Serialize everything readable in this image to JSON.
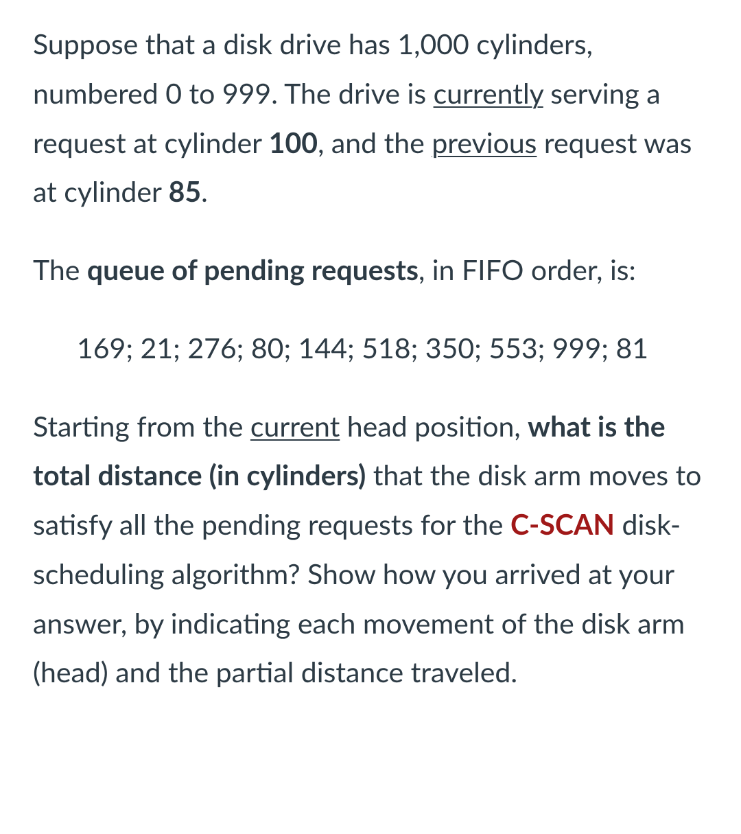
{
  "para1": {
    "seg1": "Suppose that a disk drive has 1,000 cylinders, numbered 0 to 999. The drive is ",
    "currently": "currently",
    "seg2": " serving a request at cylinder ",
    "cyl100": "100",
    "seg3": ", and the ",
    "previous": "previous",
    "seg4": " request was at cylinder ",
    "cyl85": "85",
    "seg5": "."
  },
  "para2": {
    "seg1": "The ",
    "queue": "queue of pending requests",
    "seg2": ", in FIFO order, is:"
  },
  "queue_values": "169; 21; 276; 80; 144; 518; 350; 553; 999; 81",
  "para4": {
    "seg1": "Starting from the ",
    "current": "current",
    "seg2": " head position, ",
    "bold1": "what is the total distance (in cylinders)",
    "seg3": " that the disk arm moves to satisfy all the pending requests for the ",
    "cscan": "C-SCAN",
    "seg4": " disk-scheduling algorithm? Show how you arrived at your answer, by indicating each movement of the disk arm (head) and the partial distance traveled."
  }
}
